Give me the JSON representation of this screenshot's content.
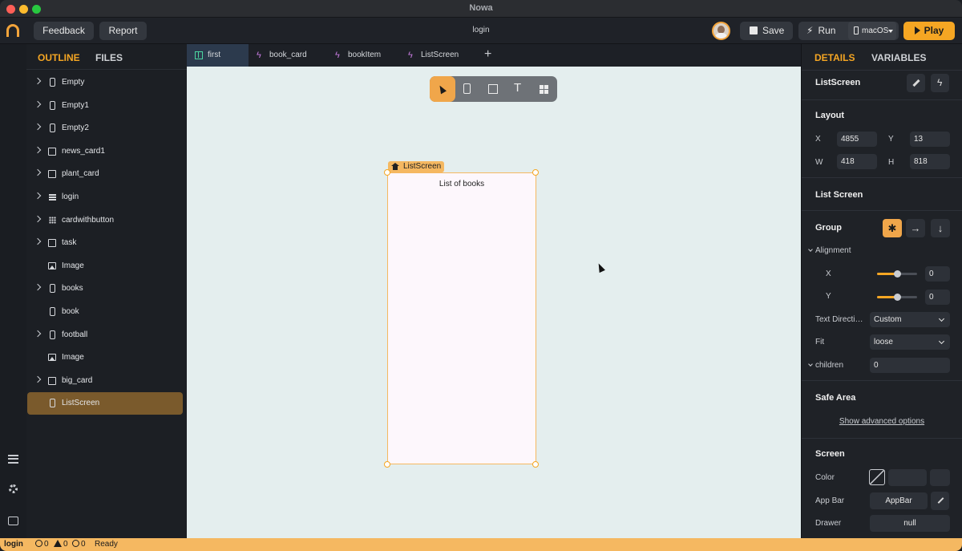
{
  "window": {
    "title": "Nowa"
  },
  "toolbar": {
    "feedback_label": "Feedback",
    "report_label": "Report",
    "center_title": "login",
    "save_label": "Save",
    "run_label": "Run",
    "platform_label": "macOS",
    "play_label": "Play"
  },
  "left": {
    "tabs": {
      "outline": "OUTLINE",
      "files": "FILES"
    },
    "items": [
      {
        "label": "Empty",
        "icon": "phone-icon"
      },
      {
        "label": "Empty1",
        "icon": "phone-icon"
      },
      {
        "label": "Empty2",
        "icon": "phone-icon"
      },
      {
        "label": "news_card1",
        "icon": "box-icon"
      },
      {
        "label": "plant_card",
        "icon": "box-icon"
      },
      {
        "label": "login",
        "icon": "list-icon"
      },
      {
        "label": "cardwithbutton",
        "icon": "grid-icon"
      },
      {
        "label": "task",
        "icon": "box-icon"
      },
      {
        "label": "Image",
        "icon": "image-icon"
      },
      {
        "label": "books",
        "icon": "phone-icon"
      },
      {
        "label": "book",
        "icon": "phone-icon"
      },
      {
        "label": "football",
        "icon": "phone-icon"
      },
      {
        "label": "Image",
        "icon": "image-icon"
      },
      {
        "label": "big_card",
        "icon": "box-icon"
      },
      {
        "label": "ListScreen",
        "icon": "phone-icon",
        "selected": true
      }
    ]
  },
  "editor": {
    "tabs": [
      {
        "label": "first",
        "icon": "grid-icon",
        "active": true
      },
      {
        "label": "book_card",
        "icon": "bolt-icon"
      },
      {
        "label": "bookItem",
        "icon": "bolt-icon"
      },
      {
        "label": "ListScreen",
        "icon": "bolt-icon"
      }
    ],
    "add_tab": "+",
    "frame_tag": "ListScreen",
    "frame_title": "List of books",
    "tools": [
      "select-tool",
      "device-tool",
      "container-tool",
      "text-tool",
      "component-tool"
    ],
    "text_tool_glyph": "T"
  },
  "right": {
    "tabs": {
      "details": "DETAILS",
      "variables": "VARIABLES"
    },
    "component_name": "ListScreen",
    "layout": {
      "title": "Layout",
      "x_label": "X",
      "x_value": "4855",
      "y_label": "Y",
      "y_value": "13",
      "w_label": "W",
      "w_value": "418",
      "h_label": "H",
      "h_value": "818"
    },
    "list_screen_title": "List Screen",
    "group": {
      "title": "Group",
      "alignment_label": "Alignment",
      "align_x_label": "X",
      "align_x_value": "0",
      "align_x_level": 0.5,
      "align_y_label": "Y",
      "align_y_value": "0",
      "align_y_level": 0.5,
      "text_direction_label": "Text Directi…",
      "text_direction_value": "Custom",
      "fit_label": "Fit",
      "fit_value": "loose",
      "children_label": "children",
      "children_value": "0"
    },
    "safe_area": {
      "title": "Safe Area",
      "advanced_link": "Show advanced options"
    },
    "screen": {
      "title": "Screen",
      "color_label": "Color",
      "appbar_label": "App Bar",
      "appbar_value": "AppBar",
      "drawer_label": "Drawer",
      "drawer_value": "null"
    }
  },
  "statusbar": {
    "branch": "login",
    "errors": "0",
    "warnings": "0",
    "infos": "0",
    "status": "Ready"
  }
}
